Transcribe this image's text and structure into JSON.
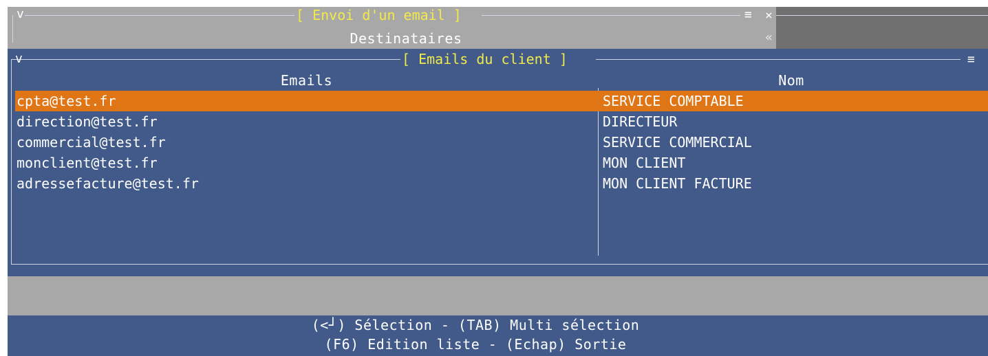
{
  "dialog": {
    "title": "[ Envoi d'un email ]",
    "subtitle": "Destinataires",
    "collapse_glyph": "v",
    "menu_glyph": "≡",
    "close_glyph": "×",
    "back_glyph": "«"
  },
  "emails_panel": {
    "title": "[ Emails du client ]",
    "collapse_glyph": "v",
    "menu_glyph": "≡",
    "columns": [
      "Emails",
      "Nom"
    ],
    "rows": [
      {
        "email": "cpta@test.fr",
        "nom": "SERVICE COMPTABLE",
        "selected": true
      },
      {
        "email": "direction@test.fr",
        "nom": "DIRECTEUR",
        "selected": false
      },
      {
        "email": "commercial@test.fr",
        "nom": "SERVICE COMMERCIAL",
        "selected": false
      },
      {
        "email": "monclient@test.fr",
        "nom": "MON CLIENT",
        "selected": false
      },
      {
        "email": "adressefacture@test.fr",
        "nom": "MON CLIENT FACTURE",
        "selected": false
      }
    ]
  },
  "footer": {
    "line1": "(<┘) Sélection - (TAB) Multi sélection",
    "line2": "(F6) Edition liste - (Echap) Sortie"
  },
  "colors": {
    "panel_blue": "#415a8a",
    "header_gray": "#a8a8a8",
    "header_dark": "#707070",
    "selection_orange": "#e07516",
    "title_yellow": "#f2e94b"
  }
}
